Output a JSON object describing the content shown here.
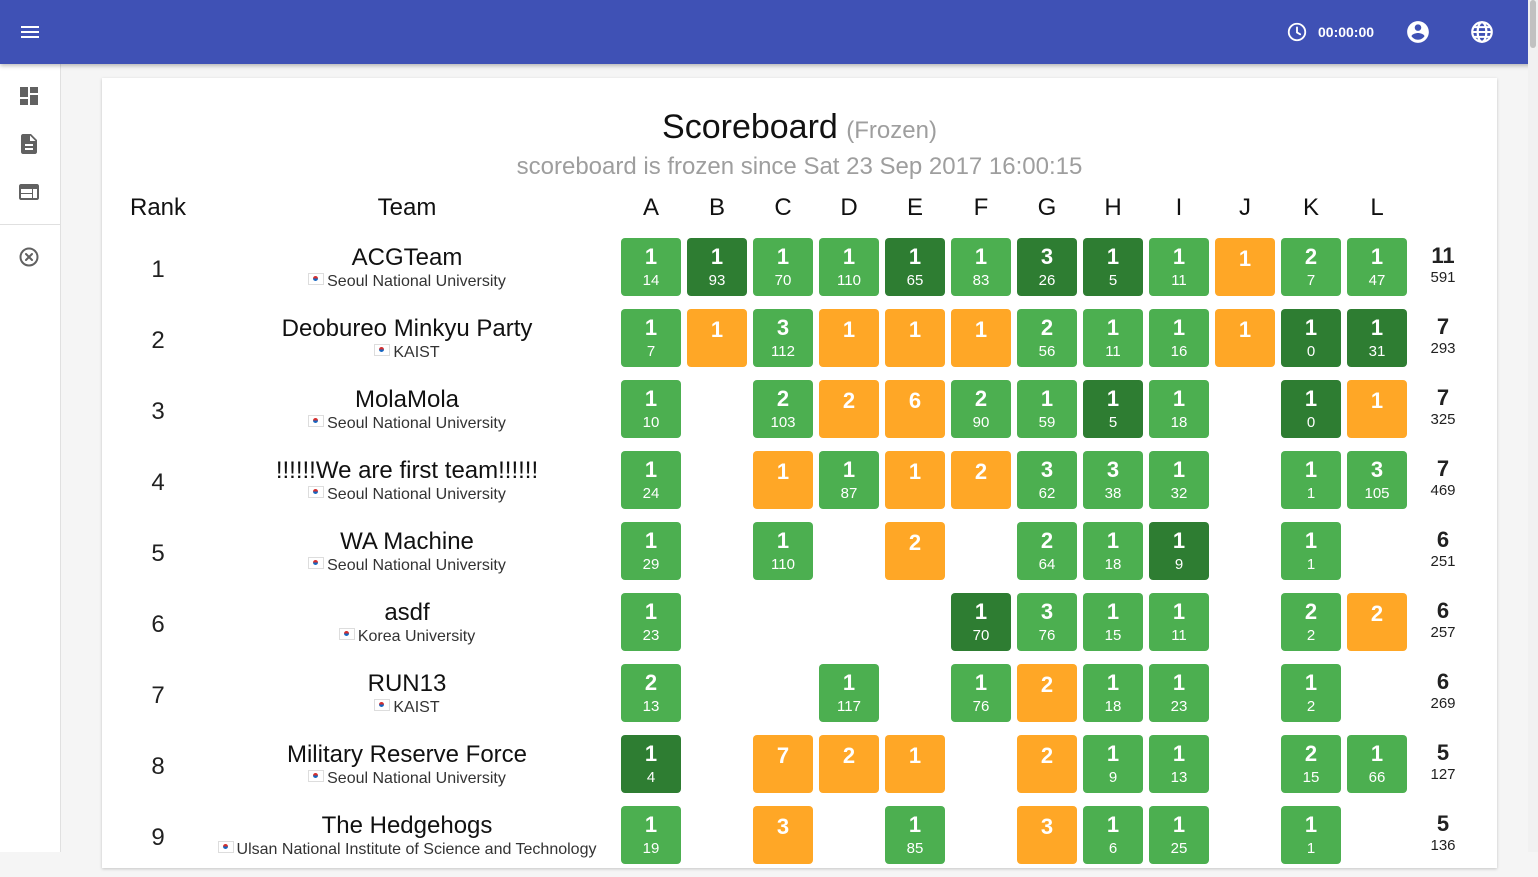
{
  "header": {
    "timer": "00:00:00",
    "icons": [
      "menu-icon",
      "clock-icon",
      "account-icon",
      "globe-icon"
    ],
    "color": "#3f51b5"
  },
  "sidebar": {
    "icons": [
      "dashboard-icon",
      "description-icon",
      "web-icon",
      "cancel-icon"
    ]
  },
  "scoreboard": {
    "title": "Scoreboard",
    "frozen_label": "(Frozen)",
    "subtitle": "scoreboard is frozen since Sat 23 Sep 2017 16:00:15",
    "headers": {
      "rank": "Rank",
      "team": "Team"
    },
    "problems": [
      "A",
      "B",
      "C",
      "D",
      "E",
      "F",
      "G",
      "H",
      "I",
      "J",
      "K",
      "L"
    ],
    "colors": {
      "solved": "#4caf50",
      "first_solve": "#2e7d32",
      "pending": "#ffa726"
    },
    "rows": [
      {
        "rank": "1",
        "team": "ACGTeam",
        "affiliation": "Seoul National University",
        "solved": "11",
        "penalty": "591",
        "cells": [
          {
            "s": "solved",
            "t": "1",
            "m": "14"
          },
          {
            "s": "first",
            "t": "1",
            "m": "93"
          },
          {
            "s": "solved",
            "t": "1",
            "m": "70"
          },
          {
            "s": "solved",
            "t": "1",
            "m": "110"
          },
          {
            "s": "first",
            "t": "1",
            "m": "65"
          },
          {
            "s": "solved",
            "t": "1",
            "m": "83"
          },
          {
            "s": "first",
            "t": "3",
            "m": "26"
          },
          {
            "s": "first",
            "t": "1",
            "m": "5"
          },
          {
            "s": "solved",
            "t": "1",
            "m": "11"
          },
          {
            "s": "pending",
            "t": "1",
            "m": ""
          },
          {
            "s": "solved",
            "t": "2",
            "m": "7"
          },
          {
            "s": "solved",
            "t": "1",
            "m": "47"
          }
        ]
      },
      {
        "rank": "2",
        "team": "Deobureo Minkyu Party",
        "affiliation": "KAIST",
        "solved": "7",
        "penalty": "293",
        "cells": [
          {
            "s": "solved",
            "t": "1",
            "m": "7"
          },
          {
            "s": "pending",
            "t": "1",
            "m": ""
          },
          {
            "s": "solved",
            "t": "3",
            "m": "112"
          },
          {
            "s": "pending",
            "t": "1",
            "m": ""
          },
          {
            "s": "pending",
            "t": "1",
            "m": ""
          },
          {
            "s": "pending",
            "t": "1",
            "m": ""
          },
          {
            "s": "solved",
            "t": "2",
            "m": "56"
          },
          {
            "s": "solved",
            "t": "1",
            "m": "11"
          },
          {
            "s": "solved",
            "t": "1",
            "m": "16"
          },
          {
            "s": "pending",
            "t": "1",
            "m": ""
          },
          {
            "s": "first",
            "t": "1",
            "m": "0"
          },
          {
            "s": "first",
            "t": "1",
            "m": "31"
          }
        ]
      },
      {
        "rank": "3",
        "team": "MolaMola",
        "affiliation": "Seoul National University",
        "solved": "7",
        "penalty": "325",
        "cells": [
          {
            "s": "solved",
            "t": "1",
            "m": "10"
          },
          null,
          {
            "s": "solved",
            "t": "2",
            "m": "103"
          },
          {
            "s": "pending",
            "t": "2",
            "m": ""
          },
          {
            "s": "pending",
            "t": "6",
            "m": ""
          },
          {
            "s": "solved",
            "t": "2",
            "m": "90"
          },
          {
            "s": "solved",
            "t": "1",
            "m": "59"
          },
          {
            "s": "first",
            "t": "1",
            "m": "5"
          },
          {
            "s": "solved",
            "t": "1",
            "m": "18"
          },
          null,
          {
            "s": "first",
            "t": "1",
            "m": "0"
          },
          {
            "s": "pending",
            "t": "1",
            "m": ""
          }
        ]
      },
      {
        "rank": "4",
        "team": "!!!!!!We are first team!!!!!!",
        "affiliation": "Seoul National University",
        "solved": "7",
        "penalty": "469",
        "cells": [
          {
            "s": "solved",
            "t": "1",
            "m": "24"
          },
          null,
          {
            "s": "pending",
            "t": "1",
            "m": ""
          },
          {
            "s": "solved",
            "t": "1",
            "m": "87"
          },
          {
            "s": "pending",
            "t": "1",
            "m": ""
          },
          {
            "s": "pending",
            "t": "2",
            "m": ""
          },
          {
            "s": "solved",
            "t": "3",
            "m": "62"
          },
          {
            "s": "solved",
            "t": "3",
            "m": "38"
          },
          {
            "s": "solved",
            "t": "1",
            "m": "32"
          },
          null,
          {
            "s": "solved",
            "t": "1",
            "m": "1"
          },
          {
            "s": "solved",
            "t": "3",
            "m": "105"
          }
        ]
      },
      {
        "rank": "5",
        "team": "WA Machine",
        "affiliation": "Seoul National University",
        "solved": "6",
        "penalty": "251",
        "cells": [
          {
            "s": "solved",
            "t": "1",
            "m": "29"
          },
          null,
          {
            "s": "solved",
            "t": "1",
            "m": "110"
          },
          null,
          {
            "s": "pending",
            "t": "2",
            "m": ""
          },
          null,
          {
            "s": "solved",
            "t": "2",
            "m": "64"
          },
          {
            "s": "solved",
            "t": "1",
            "m": "18"
          },
          {
            "s": "first",
            "t": "1",
            "m": "9"
          },
          null,
          {
            "s": "solved",
            "t": "1",
            "m": "1"
          },
          null
        ]
      },
      {
        "rank": "6",
        "team": "asdf",
        "affiliation": "Korea University",
        "solved": "6",
        "penalty": "257",
        "cells": [
          {
            "s": "solved",
            "t": "1",
            "m": "23"
          },
          null,
          null,
          null,
          null,
          {
            "s": "first",
            "t": "1",
            "m": "70"
          },
          {
            "s": "solved",
            "t": "3",
            "m": "76"
          },
          {
            "s": "solved",
            "t": "1",
            "m": "15"
          },
          {
            "s": "solved",
            "t": "1",
            "m": "11"
          },
          null,
          {
            "s": "solved",
            "t": "2",
            "m": "2"
          },
          {
            "s": "pending",
            "t": "2",
            "m": ""
          }
        ]
      },
      {
        "rank": "7",
        "team": "RUN13",
        "affiliation": "KAIST",
        "solved": "6",
        "penalty": "269",
        "cells": [
          {
            "s": "solved",
            "t": "2",
            "m": "13"
          },
          null,
          null,
          {
            "s": "solved",
            "t": "1",
            "m": "117"
          },
          null,
          {
            "s": "solved",
            "t": "1",
            "m": "76"
          },
          {
            "s": "pending",
            "t": "2",
            "m": ""
          },
          {
            "s": "solved",
            "t": "1",
            "m": "18"
          },
          {
            "s": "solved",
            "t": "1",
            "m": "23"
          },
          null,
          {
            "s": "solved",
            "t": "1",
            "m": "2"
          },
          null
        ]
      },
      {
        "rank": "8",
        "team": "Military Reserve Force",
        "affiliation": "Seoul National University",
        "solved": "5",
        "penalty": "127",
        "cells": [
          {
            "s": "first",
            "t": "1",
            "m": "4"
          },
          null,
          {
            "s": "pending",
            "t": "7",
            "m": ""
          },
          {
            "s": "pending",
            "t": "2",
            "m": ""
          },
          {
            "s": "pending",
            "t": "1",
            "m": ""
          },
          null,
          {
            "s": "pending",
            "t": "2",
            "m": ""
          },
          {
            "s": "solved",
            "t": "1",
            "m": "9"
          },
          {
            "s": "solved",
            "t": "1",
            "m": "13"
          },
          null,
          {
            "s": "solved",
            "t": "2",
            "m": "15"
          },
          {
            "s": "solved",
            "t": "1",
            "m": "66"
          }
        ]
      },
      {
        "rank": "9",
        "team": "The Hedgehogs",
        "affiliation": "Ulsan National Institute of Science and Technology",
        "solved": "5",
        "penalty": "136",
        "cells": [
          {
            "s": "solved",
            "t": "1",
            "m": "19"
          },
          null,
          {
            "s": "pending",
            "t": "3",
            "m": ""
          },
          null,
          {
            "s": "solved",
            "t": "1",
            "m": "85"
          },
          null,
          {
            "s": "pending",
            "t": "3",
            "m": ""
          },
          {
            "s": "solved",
            "t": "1",
            "m": "6"
          },
          {
            "s": "solved",
            "t": "1",
            "m": "25"
          },
          null,
          {
            "s": "solved",
            "t": "1",
            "m": "1"
          },
          null
        ]
      }
    ]
  }
}
